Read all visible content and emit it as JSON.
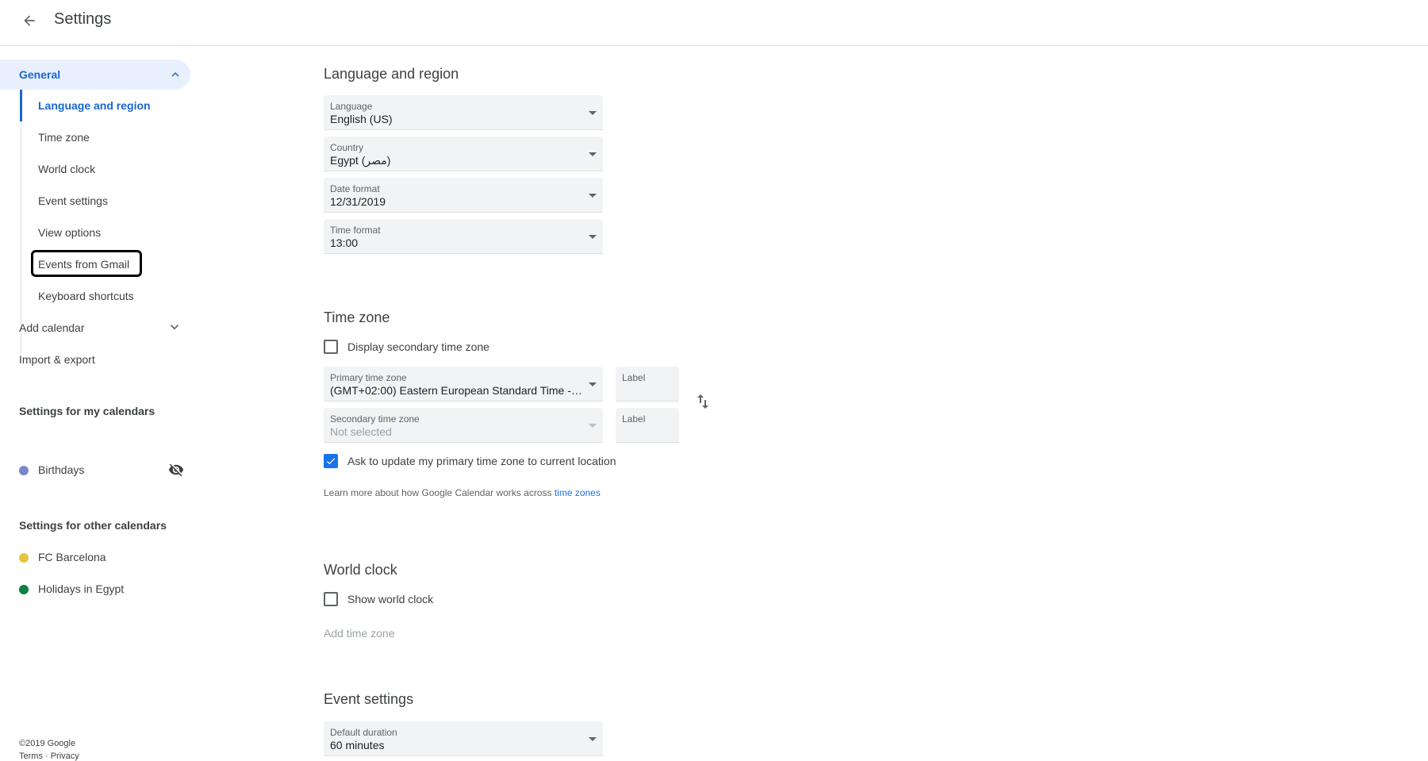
{
  "header": {
    "title": "Settings"
  },
  "sidebar": {
    "general_label": "General",
    "subitems": [
      {
        "label": "Language and region"
      },
      {
        "label": "Time zone"
      },
      {
        "label": "World clock"
      },
      {
        "label": "Event settings"
      },
      {
        "label": "View options"
      },
      {
        "label": "Events from Gmail"
      },
      {
        "label": "Keyboard shortcuts"
      }
    ],
    "add_calendar": "Add calendar",
    "import_export": "Import & export",
    "my_calendars_heading": "Settings for my calendars",
    "my_calendars": [
      {
        "label": "Birthdays",
        "color": "#7986cb"
      }
    ],
    "other_calendars_heading": "Settings for other calendars",
    "other_calendars": [
      {
        "label": "FC Barcelona",
        "color": "#e4c441"
      },
      {
        "label": "Holidays in Egypt",
        "color": "#0b8043"
      }
    ],
    "footer": "©2019 Google",
    "footer_links": "Terms · Privacy"
  },
  "language_region": {
    "title": "Language and region",
    "language": {
      "caption": "Language",
      "value": "English (US)"
    },
    "country": {
      "caption": "Country",
      "value": "Egypt (مصر)"
    },
    "date_format": {
      "caption": "Date format",
      "value": "12/31/2019"
    },
    "time_format": {
      "caption": "Time format",
      "value": "13:00"
    }
  },
  "time_zone": {
    "title": "Time zone",
    "display_secondary": "Display secondary time zone",
    "primary": {
      "caption": "Primary time zone",
      "value": "(GMT+02:00) Eastern European Standard Time - C..."
    },
    "primary_label": "Label",
    "secondary": {
      "caption": "Secondary time zone",
      "value": "Not selected"
    },
    "secondary_label": "Label",
    "ask_update": "Ask to update my primary time zone to current location",
    "help_text": "Learn more about how Google Calendar works across ",
    "help_link": "time zones"
  },
  "world_clock": {
    "title": "World clock",
    "show": "Show world clock",
    "add_tz": "Add time zone"
  },
  "event_settings": {
    "title": "Event settings",
    "default_duration": {
      "caption": "Default duration",
      "value": "60 minutes"
    }
  }
}
